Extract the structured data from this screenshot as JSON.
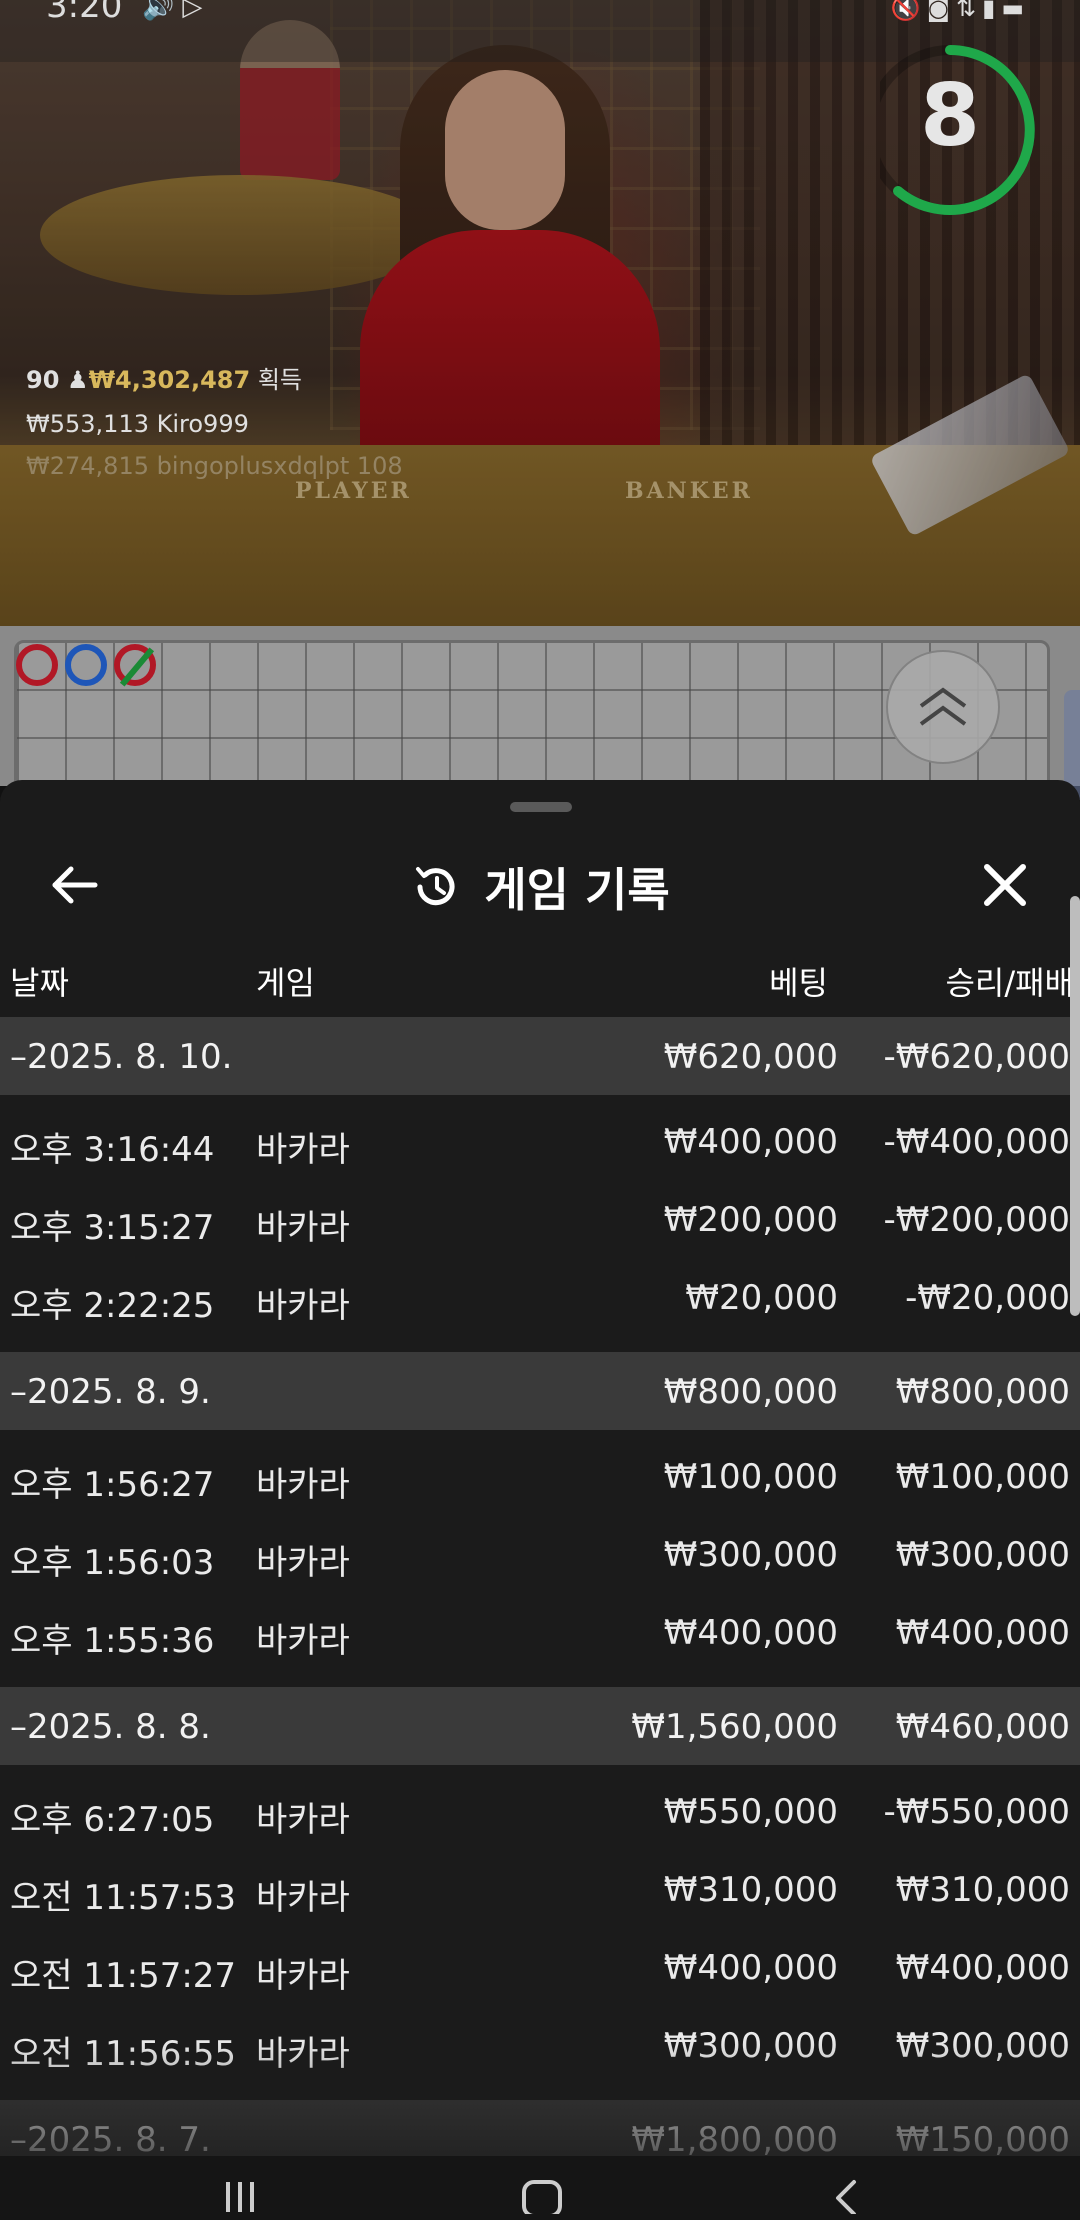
{
  "status_bar": {
    "time": "3:20",
    "left_icons": [
      "sound-icon",
      "play-icon"
    ],
    "right_icons": [
      "mute-icon",
      "voice-icon",
      "data-icon",
      "signal-icon",
      "battery-icon"
    ]
  },
  "video": {
    "countdown": "8",
    "table_labels": {
      "player": "PLAYER",
      "banker": "BANKER"
    },
    "winners": {
      "count": "90",
      "total": "₩4,302,487",
      "suffix": "획득",
      "entries": [
        {
          "amount": "₩553,113",
          "name": "Kiro999"
        },
        {
          "amount": "₩274,815",
          "name": "bingoplusxdqlpt 108"
        }
      ]
    }
  },
  "colors": {
    "countdown_ring": "#1fa84a",
    "road_player": "#1e56b8",
    "road_banker": "#b11826",
    "road_tie": "#1b8a36"
  },
  "sheet": {
    "title": "게임 기록",
    "columns": {
      "date": "날짜",
      "game": "게임",
      "bet": "베팅",
      "win_loss": "승리/패배"
    },
    "days": [
      {
        "date": "–2025. 8. 10.",
        "bet": "₩620,000",
        "win_loss": "-₩620,000",
        "rows": [
          {
            "time": "오후 3:16:44",
            "game": "바카라",
            "bet": "₩400,000",
            "win_loss": "-₩400,000"
          },
          {
            "time": "오후 3:15:27",
            "game": "바카라",
            "bet": "₩200,000",
            "win_loss": "-₩200,000"
          },
          {
            "time": "오후 2:22:25",
            "game": "바카라",
            "bet": "₩20,000",
            "win_loss": "-₩20,000"
          }
        ]
      },
      {
        "date": "–2025. 8. 9.",
        "bet": "₩800,000",
        "win_loss": "₩800,000",
        "rows": [
          {
            "time": "오후 1:56:27",
            "game": "바카라",
            "bet": "₩100,000",
            "win_loss": "₩100,000"
          },
          {
            "time": "오후 1:56:03",
            "game": "바카라",
            "bet": "₩300,000",
            "win_loss": "₩300,000"
          },
          {
            "time": "오후 1:55:36",
            "game": "바카라",
            "bet": "₩400,000",
            "win_loss": "₩400,000"
          }
        ]
      },
      {
        "date": "–2025. 8. 8.",
        "bet": "₩1,560,000",
        "win_loss": "₩460,000",
        "rows": [
          {
            "time": "오후 6:27:05",
            "game": "바카라",
            "bet": "₩550,000",
            "win_loss": "-₩550,000"
          },
          {
            "time": "오전 11:57:53",
            "game": "바카라",
            "bet": "₩310,000",
            "win_loss": "₩310,000"
          },
          {
            "time": "오전 11:57:27",
            "game": "바카라",
            "bet": "₩400,000",
            "win_loss": "₩400,000"
          },
          {
            "time": "오전 11:56:55",
            "game": "바카라",
            "bet": "₩300,000",
            "win_loss": "₩300,000"
          }
        ]
      },
      {
        "date": "–2025. 8. 7.",
        "bet": "₩1,800,000",
        "win_loss": "₩150,000",
        "rows": []
      }
    ]
  },
  "navbar": {
    "icons": [
      "recent-apps-icon",
      "home-icon",
      "back-icon"
    ]
  }
}
